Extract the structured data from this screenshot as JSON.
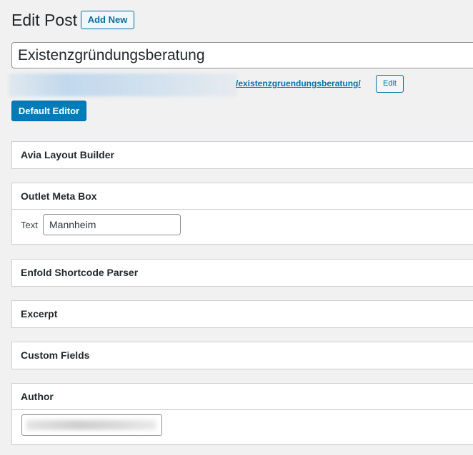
{
  "header": {
    "title": "Edit Post",
    "add_new_label": "Add New"
  },
  "post": {
    "title": "Existenzgründungsberatung",
    "permalink_slug": "/existenzgruendungsberatung/",
    "edit_slug_label": "Edit",
    "default_editor_label": "Default Editor"
  },
  "boxes": {
    "avia": "Avia Layout Builder",
    "outlet": {
      "title": "Outlet Meta Box",
      "field_label": "Text",
      "field_value": "Mannheim"
    },
    "enfold": "Enfold Shortcode Parser",
    "excerpt": "Excerpt",
    "custom_fields": "Custom Fields",
    "author": "Author"
  },
  "colors": {
    "primary": "#007cba",
    "link": "#0073aa",
    "background": "#f1f1f1",
    "border": "#ccd0d4"
  }
}
